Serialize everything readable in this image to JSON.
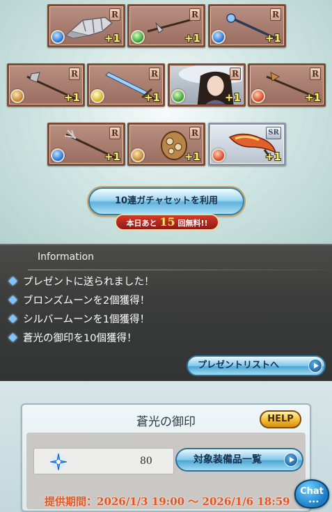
{
  "gacha": {
    "results": [
      {
        "rarity": "R",
        "element": "water",
        "icon": "gauntlet-weapon-icon",
        "plus": "+1"
      },
      {
        "rarity": "R",
        "element": "wind",
        "icon": "spear-weapon-icon",
        "plus": "+1"
      },
      {
        "rarity": "R",
        "element": "water",
        "icon": "staff-weapon-icon",
        "plus": "+1"
      },
      {
        "rarity": "R",
        "element": "earth",
        "icon": "axe-spear-weapon-icon",
        "plus": "+1"
      },
      {
        "rarity": "R",
        "element": "light",
        "icon": "sword-weapon-icon",
        "plus": "+1"
      },
      {
        "rarity": "R",
        "element": "wind",
        "icon": "character-portrait-icon",
        "plus": "+1"
      },
      {
        "rarity": "R",
        "element": "fire",
        "icon": "spear-weapon-icon",
        "plus": "+1"
      },
      {
        "rarity": "R",
        "element": "water",
        "icon": "trident-weapon-icon",
        "plus": "+1"
      },
      {
        "rarity": "R",
        "element": "earth",
        "icon": "shield-gear-icon",
        "plus": "+1"
      },
      {
        "rarity": "SR",
        "element": "fire",
        "icon": "flame-blade-icon",
        "plus": "+1"
      }
    ],
    "draw_button": "10連ガチャセットを利用",
    "free_prefix": "本日あと",
    "free_count": "15",
    "free_suffix": "回無料!!"
  },
  "info": {
    "title": "Information",
    "lines": [
      "プレゼントに送られました！",
      "ブロンズムーンを2個獲得！",
      "シルバームーンを1個獲得！",
      "蒼光の御印を10個獲得！"
    ],
    "present_button": "プレゼントリストへ"
  },
  "seal": {
    "title": "蒼光の御印",
    "help": "HELP",
    "count": "80",
    "equip_button": "対象装備品一覧",
    "period": "提供期間：2026/1/3 19:00 〜 2026/1/6 18:59"
  },
  "chat": {
    "label": "Chat",
    "dots": "•••"
  }
}
